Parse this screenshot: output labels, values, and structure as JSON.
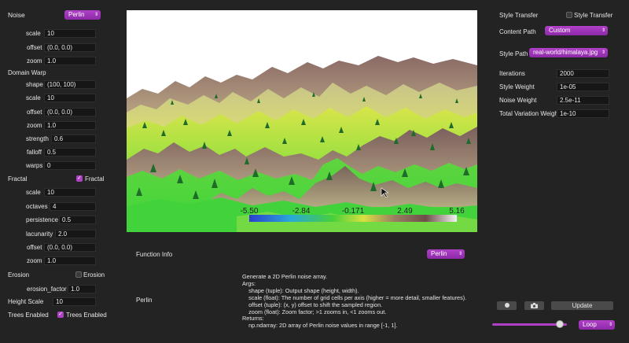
{
  "left_panel": {
    "noise": {
      "label": "Noise",
      "type_value": "Perlin",
      "scale_label": "scale",
      "scale_value": "10",
      "offset_label": "offset",
      "offset_value": "(0.0, 0.0)",
      "zoom_label": "zoom",
      "zoom_value": "1.0"
    },
    "domain_warp": {
      "heading": "Domain Warp",
      "shape_label": "shape",
      "shape_value": "(100, 100)",
      "scale_label": "scale",
      "scale_value": "10",
      "offset_label": "offset",
      "offset_value": "(0.0, 0.0)",
      "zoom_label": "zoom",
      "zoom_value": "1.0",
      "strength_label": "strength",
      "strength_value": "0.6",
      "falloff_label": "falloff",
      "falloff_value": "0.5",
      "warps_label": "warps",
      "warps_value": "0"
    },
    "fractal": {
      "heading": "Fractal",
      "checkbox_label": "Fractal",
      "checked": true,
      "scale_label": "scale",
      "scale_value": "10",
      "octaves_label": "octaves",
      "octaves_value": "4",
      "persistence_label": "persistence",
      "persistence_value": "0.5",
      "lacunarity_label": "lacunarity",
      "lacunarity_value": "2.0",
      "offset_label": "offset",
      "offset_value": "(0.0, 0.0)",
      "zoom_label": "zoom",
      "zoom_value": "1.0"
    },
    "erosion": {
      "heading": "Erosion",
      "checkbox_label": "Erosion",
      "checked": false,
      "factor_label": "erosion_factor",
      "factor_value": "1.0"
    },
    "height_scale": {
      "label": "Height Scale",
      "value": "10"
    },
    "trees": {
      "label": "Trees Enabled",
      "checkbox_label": "Trees Enabled",
      "checked": true
    }
  },
  "colorbar": {
    "ticks": [
      "-5.50",
      "-2.84",
      "-0.171",
      "2.49",
      "5.16"
    ]
  },
  "function_info": {
    "label": "Function Info",
    "select_value": "Perlin",
    "name": "Perlin",
    "doc_lines": [
      "Generate a 2D Perlin noise array.",
      "Args:",
      "    shape (tuple): Output shape (height, width).",
      "    scale (float): The number of grid cells per axis (higher = more detail, smaller features).",
      "    offset (tuple): (x, y) offset to shift the sampled region.",
      "    zoom (float): Zoom factor; >1 zooms in, <1 zooms out.",
      "Returns:",
      "    np.ndarray: 2D array of Perlin noise values in range [-1, 1]."
    ]
  },
  "right_panel": {
    "style_transfer": {
      "label": "Style Transfer",
      "checkbox_label": "Style Transfer",
      "checked": false
    },
    "content_path": {
      "label": "Content Path",
      "value": "Custom"
    },
    "style_path": {
      "label": "Style Path",
      "value": "real-world/himalaya.jpg"
    },
    "iterations": {
      "label": "Iterations",
      "value": "2000"
    },
    "style_weight": {
      "label": "Style Weight",
      "value": "1e-05"
    },
    "noise_weight": {
      "label": "Noise Weight",
      "value": "2.5e-11"
    },
    "tv_weight": {
      "label": "Total Variation Weight",
      "value": "1e-10"
    },
    "controls": {
      "update_label": "Update",
      "loop_value": "Loop",
      "slider_position": 0.9
    },
    "icons": {
      "record": "record-icon",
      "camera": "camera-icon"
    }
  },
  "colors": {
    "accent": "#b040c8",
    "background": "#232323",
    "field": "#161616"
  }
}
